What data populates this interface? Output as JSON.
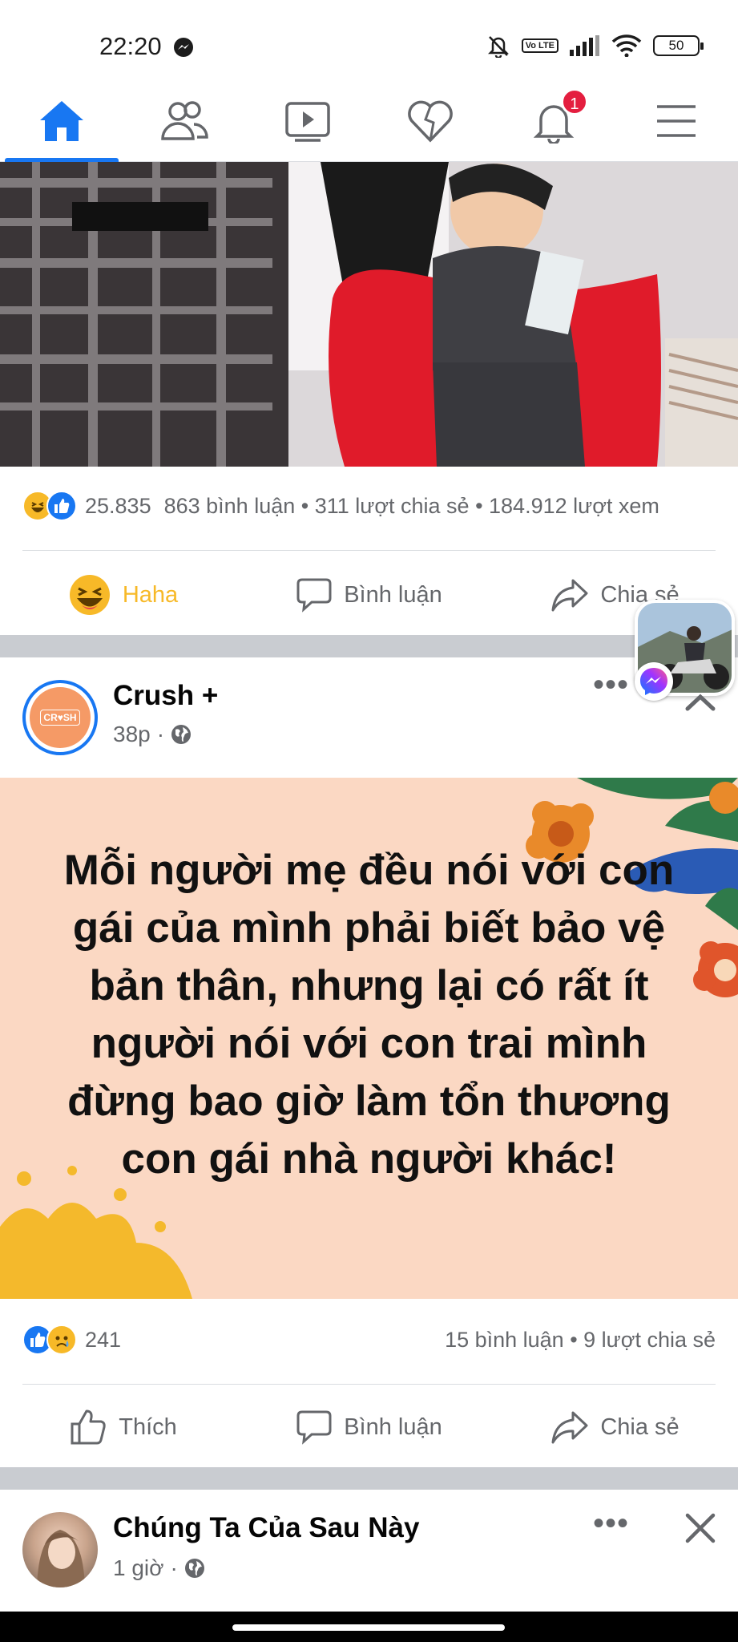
{
  "status": {
    "time": "22:20",
    "battery": "50",
    "network": "Vo LTE"
  },
  "nav": {
    "items": [
      {
        "name": "home",
        "active": true
      },
      {
        "name": "friends"
      },
      {
        "name": "watch"
      },
      {
        "name": "dating"
      },
      {
        "name": "notifications",
        "badge": "1"
      },
      {
        "name": "menu"
      }
    ]
  },
  "post1": {
    "reactions": "25.835",
    "stats": "863 bình luận • 311 lượt chia sẻ • 184.912 lượt xem",
    "actions": {
      "haha": "Haha",
      "comment": "Bình luận",
      "share": "Chia sẻ"
    }
  },
  "post2": {
    "author": "Crush +",
    "avatar_text": "CR♥SH",
    "time": "38p",
    "quote": "Mỗi người mẹ đều nói với con gái của mình phải biết bảo vệ bản thân, nhưng lại có rất ít người nói với con trai mình đừng bao giờ làm tổn thương con gái nhà người khác!",
    "reactions": "241",
    "stats": "15 bình luận • 9 lượt chia sẻ",
    "actions": {
      "like": "Thích",
      "comment": "Bình luận",
      "share": "Chia sẻ"
    }
  },
  "post3": {
    "author": "Chúng Ta Của Sau Này",
    "time": "1 giờ"
  },
  "colors": {
    "accent": "#1877f2",
    "badge": "#e41e3f",
    "haha": "#f7b928",
    "quote_bg": "#fbd8c3"
  }
}
